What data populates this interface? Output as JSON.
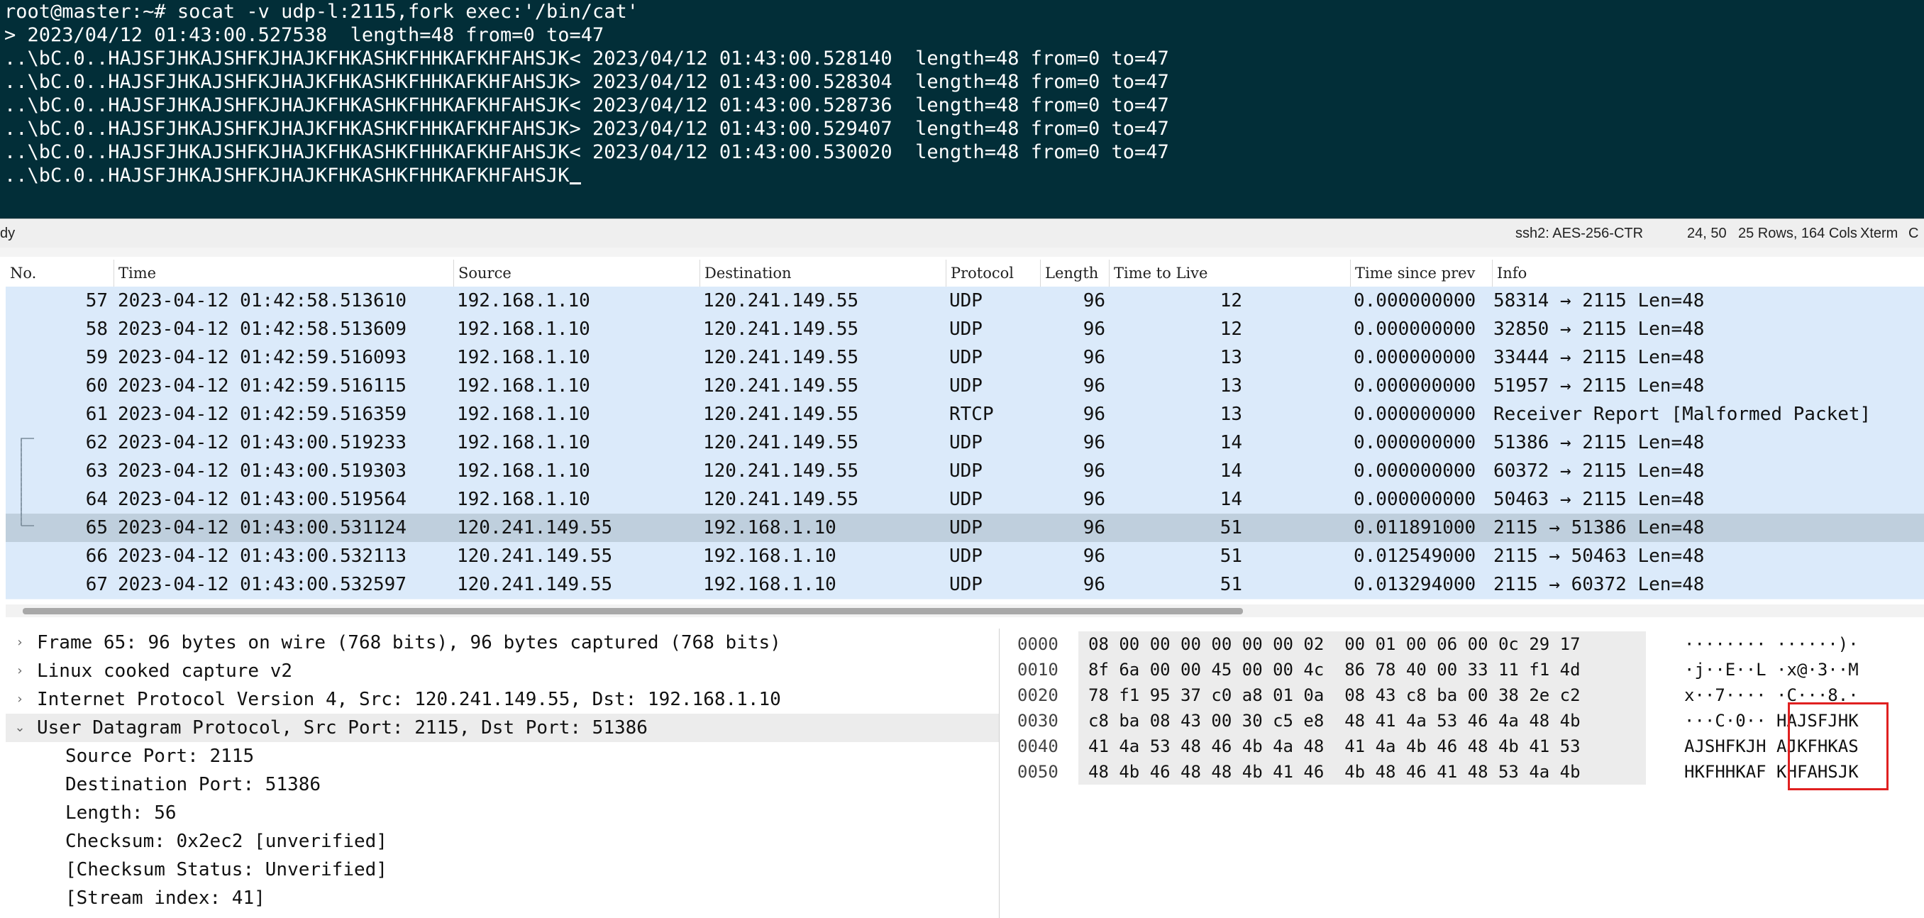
{
  "terminal": {
    "lines": [
      "root@master:~# socat -v udp-l:2115,fork exec:'/bin/cat'",
      "> 2023/04/12 01:43:00.527538  length=48 from=0 to=47",
      "..\\bC.0..HAJSFJHKAJSHFKJHAJKFHKASHKFHHKAFKHFAHSJK< 2023/04/12 01:43:00.528140  length=48 from=0 to=47",
      "..\\bC.0..HAJSFJHKAJSHFKJHAJKFHKASHKFHHKAFKHFAHSJK> 2023/04/12 01:43:00.528304  length=48 from=0 to=47",
      "..\\bC.0..HAJSFJHKAJSHFKJHAJKFHKASHKFHHKAFKHFAHSJK< 2023/04/12 01:43:00.528736  length=48 from=0 to=47",
      "..\\bC.0..HAJSFJHKAJSHFKJHAJKFHKASHKFHHKAFKHFAHSJK> 2023/04/12 01:43:00.529407  length=48 from=0 to=47",
      "..\\bC.0..HAJSFJHKAJSHFKJHAJKFHKASHKFHHKAFKHFAHSJK< 2023/04/12 01:43:00.530020  length=48 from=0 to=47",
      "..\\bC.0..HAJSFJHKAJSHFKJHAJKFHKASHKFHHKAFKHFAHSJK"
    ]
  },
  "statusbar": {
    "left": "dy",
    "cipher": "ssh2: AES-256-CTR",
    "cursor_pos": "24, 50",
    "size": "25 Rows, 164 Cols",
    "term": "Xterm",
    "right": "C"
  },
  "packet_list": {
    "columns": [
      "No.",
      "Time",
      "Source",
      "Destination",
      "Protocol",
      "Length",
      "Time to Live",
      "Time since prev",
      "Info"
    ],
    "rows": [
      {
        "no": "57",
        "time": "2023-04-12 01:42:58.513610",
        "src": "192.168.1.10",
        "dst": "120.241.149.55",
        "proto": "UDP",
        "len": "96",
        "ttl": "12",
        "tsp": "0.000000000",
        "info": "58314 → 2115 Len=48"
      },
      {
        "no": "58",
        "time": "2023-04-12 01:42:58.513609",
        "src": "192.168.1.10",
        "dst": "120.241.149.55",
        "proto": "UDP",
        "len": "96",
        "ttl": "12",
        "tsp": "0.000000000",
        "info": "32850 → 2115 Len=48"
      },
      {
        "no": "59",
        "time": "2023-04-12 01:42:59.516093",
        "src": "192.168.1.10",
        "dst": "120.241.149.55",
        "proto": "UDP",
        "len": "96",
        "ttl": "13",
        "tsp": "0.000000000",
        "info": "33444 → 2115 Len=48"
      },
      {
        "no": "60",
        "time": "2023-04-12 01:42:59.516115",
        "src": "192.168.1.10",
        "dst": "120.241.149.55",
        "proto": "UDP",
        "len": "96",
        "ttl": "13",
        "tsp": "0.000000000",
        "info": "51957 → 2115 Len=48"
      },
      {
        "no": "61",
        "time": "2023-04-12 01:42:59.516359",
        "src": "192.168.1.10",
        "dst": "120.241.149.55",
        "proto": "RTCP",
        "len": "96",
        "ttl": "13",
        "tsp": "0.000000000",
        "info": "Receiver Report   [Malformed Packet]"
      },
      {
        "no": "62",
        "time": "2023-04-12 01:43:00.519233",
        "src": "192.168.1.10",
        "dst": "120.241.149.55",
        "proto": "UDP",
        "len": "96",
        "ttl": "14",
        "tsp": "0.000000000",
        "info": "51386 → 2115 Len=48"
      },
      {
        "no": "63",
        "time": "2023-04-12 01:43:00.519303",
        "src": "192.168.1.10",
        "dst": "120.241.149.55",
        "proto": "UDP",
        "len": "96",
        "ttl": "14",
        "tsp": "0.000000000",
        "info": "60372 → 2115 Len=48"
      },
      {
        "no": "64",
        "time": "2023-04-12 01:43:00.519564",
        "src": "192.168.1.10",
        "dst": "120.241.149.55",
        "proto": "UDP",
        "len": "96",
        "ttl": "14",
        "tsp": "0.000000000",
        "info": "50463 → 2115 Len=48"
      },
      {
        "no": "65",
        "time": "2023-04-12 01:43:00.531124",
        "src": "120.241.149.55",
        "dst": "192.168.1.10",
        "proto": "UDP",
        "len": "96",
        "ttl": "51",
        "tsp": "0.011891000",
        "info": "2115 → 51386 Len=48"
      },
      {
        "no": "66",
        "time": "2023-04-12 01:43:00.532113",
        "src": "120.241.149.55",
        "dst": "192.168.1.10",
        "proto": "UDP",
        "len": "96",
        "ttl": "51",
        "tsp": "0.012549000",
        "info": "2115 → 50463 Len=48"
      },
      {
        "no": "67",
        "time": "2023-04-12 01:43:00.532597",
        "src": "120.241.149.55",
        "dst": "192.168.1.10",
        "proto": "UDP",
        "len": "96",
        "ttl": "51",
        "tsp": "0.013294000",
        "info": "2115 → 60372 Len=48"
      }
    ],
    "selected_no": "65"
  },
  "details": {
    "lines": [
      {
        "arrow": "›",
        "text": "Frame 65: 96 bytes on wire (768 bits), 96 bytes captured (768 bits)"
      },
      {
        "arrow": "›",
        "text": "Linux cooked capture v2"
      },
      {
        "arrow": "›",
        "text": "Internet Protocol Version 4, Src: 120.241.149.55, Dst: 192.168.1.10"
      },
      {
        "arrow": "⌄",
        "text": "User Datagram Protocol, Src Port: 2115, Dst Port: 51386"
      },
      {
        "arrow": "",
        "text": "Source Port: 2115"
      },
      {
        "arrow": "",
        "text": "Destination Port: 51386"
      },
      {
        "arrow": "",
        "text": "Length: 56"
      },
      {
        "arrow": "",
        "text": "Checksum: 0x2ec2 [unverified]"
      },
      {
        "arrow": "",
        "text": "[Checksum Status: Unverified]"
      },
      {
        "arrow": "",
        "text": "[Stream index: 41]"
      }
    ]
  },
  "hex": {
    "rows": [
      {
        "offset": "0000",
        "bytes": "08 00 00 00 00 00 00 02  00 01 00 06 00 0c 29 17",
        "ascii": "········ ······)·"
      },
      {
        "offset": "0010",
        "bytes": "8f 6a 00 00 45 00 00 4c  86 78 40 00 33 11 f1 4d",
        "ascii": "·j··E··L ·x@·3··M"
      },
      {
        "offset": "0020",
        "bytes": "78 f1 95 37 c0 a8 01 0a  08 43 c8 ba 00 38 2e c2",
        "ascii": "x··7···· ·C···8.·"
      },
      {
        "offset": "0030",
        "bytes": "c8 ba 08 43 00 30 c5 e8  48 41 4a 53 46 4a 48 4b",
        "ascii": "···C·0·· HAJSFJHK"
      },
      {
        "offset": "0040",
        "bytes": "41 4a 53 48 46 4b 4a 48  41 4a 4b 46 48 4b 41 53",
        "ascii": "AJSHFKJH AJKFHKAS"
      },
      {
        "offset": "0050",
        "bytes": "48 4b 46 48 48 4b 41 46  4b 48 46 41 48 53 4a 4b",
        "ascii": "HKFHHKAF KHFAHSJK"
      }
    ]
  }
}
